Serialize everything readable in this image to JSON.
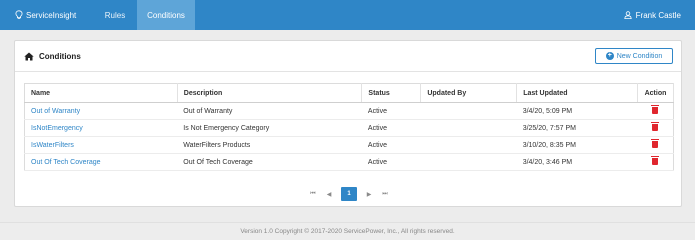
{
  "navbar": {
    "brand": "ServiceInsight",
    "links": [
      "Rules",
      "Conditions"
    ],
    "active": "Conditions",
    "user": "Frank Castle",
    "background": "#2f86c7"
  },
  "panel": {
    "title": "Conditions",
    "title_icon": "home-icon",
    "new_button": "New Condition"
  },
  "table": {
    "columns": [
      "Name",
      "Description",
      "Status",
      "Updated By",
      "Last Updated",
      "Action"
    ],
    "rows": [
      {
        "name": "Out of Warranty",
        "description": "Out of Warranty",
        "status": "Active",
        "updated_by": "",
        "last_updated": "3/4/20, 5:09 PM"
      },
      {
        "name": "IsNotEmergency",
        "description": "Is Not Emergency Category",
        "status": "Active",
        "updated_by": "",
        "last_updated": "3/25/20, 7:57 PM"
      },
      {
        "name": "IsWaterFilters",
        "description": "WaterFilters Products",
        "status": "Active",
        "updated_by": "",
        "last_updated": "3/10/20, 8:35 PM"
      },
      {
        "name": "Out Of Tech Coverage",
        "description": "Out Of Tech Coverage",
        "status": "Active",
        "updated_by": "",
        "last_updated": "3/4/20, 3:46 PM"
      }
    ],
    "action_icon": "trash-icon",
    "action_color": "#e0262e"
  },
  "pager": {
    "first": "⏮",
    "prev": "◀",
    "current": "1",
    "next": "▶",
    "last": "⏭"
  },
  "footer": {
    "text": "Version 1.0 Copyright © 2017-2020 ServicePower, Inc., All rights reserved."
  }
}
